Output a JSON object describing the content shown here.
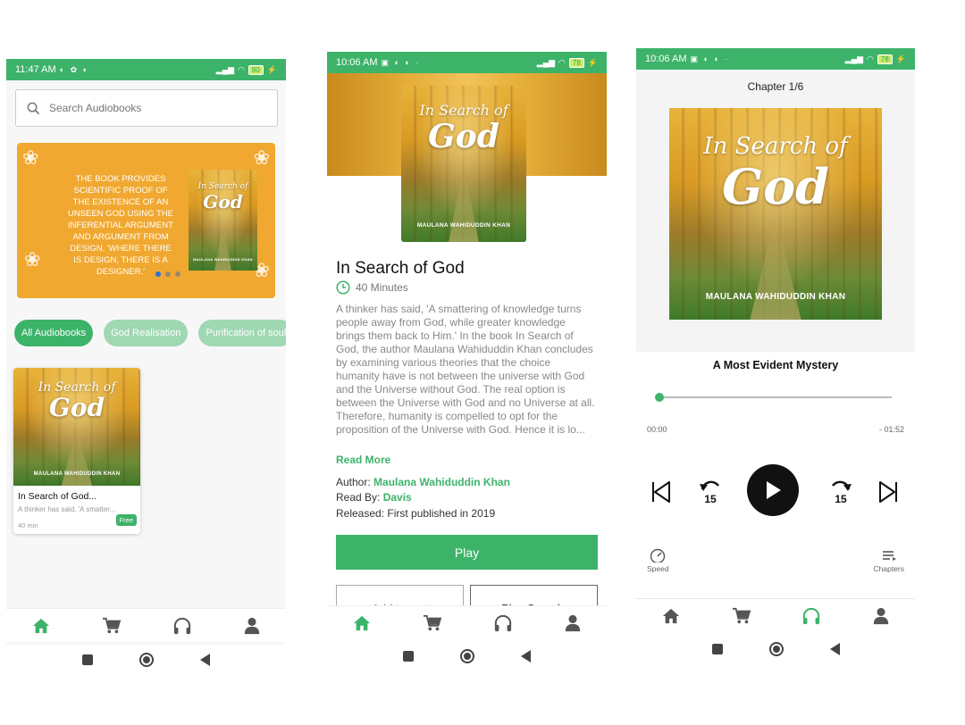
{
  "colors": {
    "accent": "#3db36a",
    "accent_light": "#9fd8b2",
    "banner": "#f0a830"
  },
  "cover": {
    "title_line1": "In Search of",
    "title_line2": "God",
    "author": "MAULANA WAHIDUDDIN KHAN"
  },
  "screen1": {
    "status": {
      "time": "11:47 AM",
      "battery": "80"
    },
    "search": {
      "placeholder": "Search Audiobooks"
    },
    "banner": {
      "text": "THE BOOK PROVIDES SCIENTIFIC PROOF OF THE EXISTENCE OF AN UNSEEN GOD USING THE INFERENTIAL ARGUMENT AND ARGUMENT FROM DESIGN. 'WHERE THERE IS DESIGN, THERE IS A DESIGNER.'",
      "slides_total": 3,
      "slide_active": 1
    },
    "chips": [
      {
        "label": "All Audiobooks",
        "active": true
      },
      {
        "label": "God Realisation",
        "active": false
      },
      {
        "label": "Purification of soul",
        "active": false
      }
    ],
    "book": {
      "title": "In Search of God...",
      "desc": "A thinker has said, 'A smatter...",
      "duration": "40 min",
      "badge": "Free"
    },
    "nav_active": "home"
  },
  "screen2": {
    "status": {
      "time": "10:06 AM",
      "battery": "78"
    },
    "title": "In Search of God",
    "duration": "40 Minutes",
    "description": "A thinker has said, 'A smattering of knowledge turns people away from God, while greater knowledge brings them back to Him.' In the book In Search of God, the author Maulana Wahiduddin Khan concludes by examining various theories that the choice humanity have is not between the universe with God and the Universe without God. The real option is between the Universe with God and no Universe at all. Therefore, humanity is compelled to opt for the proposition of the Universe with God. Hence it is lo...",
    "read_more": "Read More",
    "author_label": "Author:",
    "author": "Maulana Wahiduddin Khan",
    "readby_label": "Read By:",
    "reader": "Davis",
    "released_label": "Released:",
    "released": "First published in 2019",
    "play": "Play",
    "add_to_cart": "Add to cart",
    "play_sample": "Play Sample",
    "nav_active": "home"
  },
  "screen3": {
    "status": {
      "time": "10:06 AM",
      "battery": "78"
    },
    "chapter": "Chapter 1/6",
    "track": "A Most Evident Mystery",
    "progress": 0.0,
    "elapsed": "00:00",
    "remaining": "- 01:52",
    "skip_back": "15",
    "skip_forward": "15",
    "speed_label": "Speed",
    "chapters_label": "Chapters",
    "nav_active": "headphones"
  }
}
